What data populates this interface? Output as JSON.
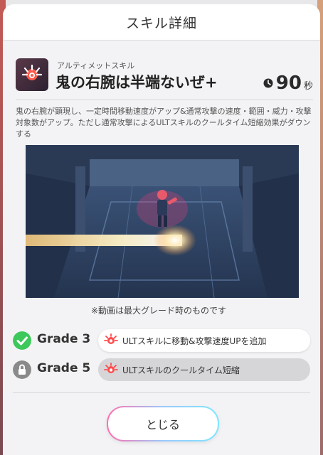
{
  "dialog": {
    "title": "スキル詳細",
    "close_label": "とじる"
  },
  "skill": {
    "type": "アルティメットスキル",
    "name": "鬼の右腕は半端ないぜ+",
    "cooldown_value": "90",
    "cooldown_unit": "秒",
    "description": "鬼の右腕が顕現し、一定時間移動速度がアップ&通常攻撃の速度・範囲・威力・攻撃対象数がアップ。ただし通常攻撃によるULTスキルのクールタイム短縮効果がダウンする",
    "icon": "demon-claw-icon"
  },
  "video": {
    "caption": "※動画は最大グレード時のものです"
  },
  "grades": [
    {
      "label": "Grade 3",
      "status": "unlocked",
      "status_icon": "check-icon",
      "effect": "ULTスキルに移動&攻撃速度UPを追加"
    },
    {
      "label": "Grade 5",
      "status": "locked",
      "status_icon": "lock-icon",
      "effect": "ULTスキルのクールタイム短縮"
    }
  ],
  "colors": {
    "unlocked": "#3cc85a",
    "locked": "#8a8a8a",
    "accent_pink": "#ff6fae",
    "accent_blue": "#7ee6ff"
  }
}
